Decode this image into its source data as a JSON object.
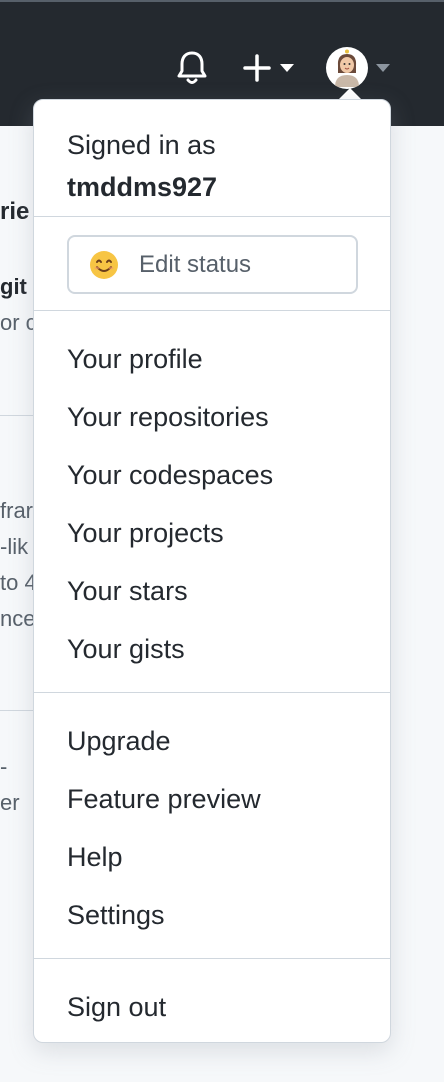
{
  "header": {
    "bell_icon": "bell-icon",
    "plus_icon": "plus-icon",
    "avatar_icon": "avatar"
  },
  "background": {
    "line1": "rie",
    "line2": "git",
    "line3": "or c",
    "line4": "frar",
    "line5": "-lik",
    "line6": "to 4",
    "line7": "nce",
    "line8": "-",
    "line9": "er"
  },
  "dropdown": {
    "signed_in_prefix": "Signed in as",
    "username": "tmddms927",
    "status_emoji": "smile-emoji-icon",
    "status_label": "Edit status",
    "profile_items": [
      "Your profile",
      "Your repositories",
      "Your codespaces",
      "Your projects",
      "Your stars",
      "Your gists"
    ],
    "misc_items": [
      "Upgrade",
      "Feature preview",
      "Help",
      "Settings"
    ],
    "sign_out": "Sign out"
  },
  "colors": {
    "header_bg": "#24292f",
    "border": "#d0d7de",
    "text": "#24292f",
    "muted": "#57606a"
  }
}
